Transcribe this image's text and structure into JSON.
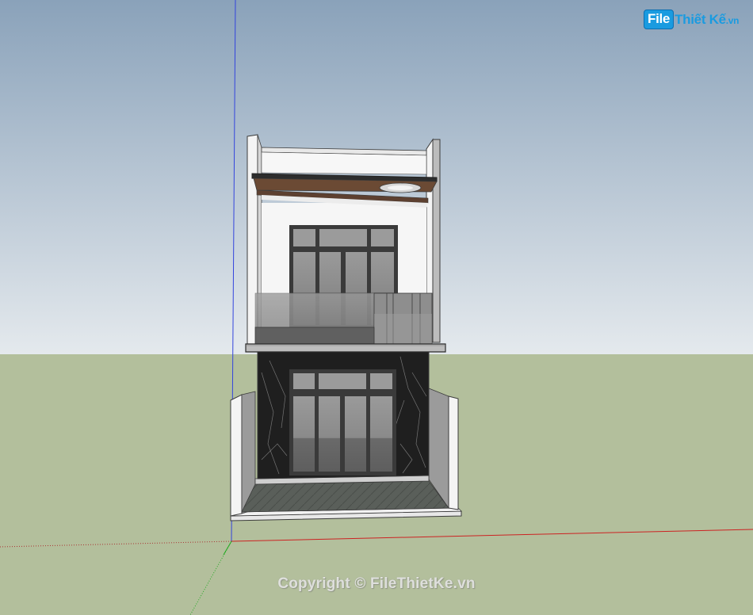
{
  "logo": {
    "brand_box": "File",
    "brand_rest": "Thiết Kế",
    "tld": ".vn"
  },
  "watermark": {
    "text": "Copyright © FileThietKe.vn"
  },
  "colors": {
    "sky_top": "#8aa2ba",
    "sky_bottom": "#e3e8ec",
    "ground": "#b3bf9c",
    "wall": "#f4f4f4",
    "marble": "#222222",
    "glass": "#7d7d7d",
    "frame": "#3b3b3b",
    "wood": "#6b4a34",
    "brand": "#1a9be0"
  }
}
